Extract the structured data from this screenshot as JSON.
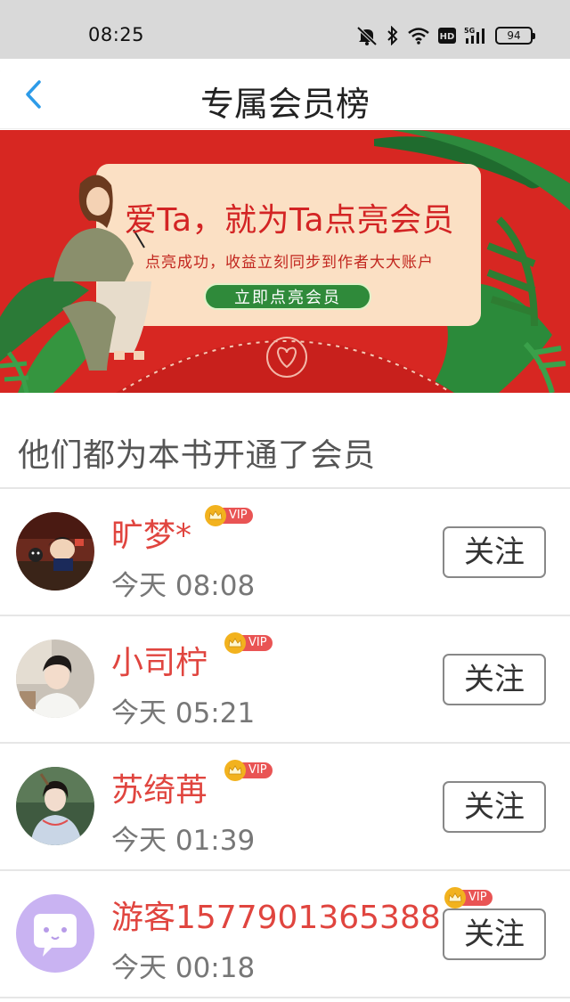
{
  "status_bar": {
    "time": "08:25",
    "icons": [
      "mute-icon",
      "bluetooth-icon",
      "wifi-icon",
      "hd-icon",
      "signal-5g-icon",
      "battery-icon"
    ],
    "battery": "94"
  },
  "header": {
    "back_icon": "chevron-left-icon",
    "title": "专属会员榜"
  },
  "banner": {
    "title": "爱Ta，就为Ta点亮会员",
    "subtitle": "点亮成功，收益立刻同步到作者大大账户",
    "cta": "立即点亮会员"
  },
  "section": {
    "title": "他们都为本书开通了会员"
  },
  "members": [
    {
      "name": "旷梦*",
      "time": "今天 08:08",
      "vip": "VIP",
      "follow": "关注"
    },
    {
      "name": "小司柠",
      "time": "今天 05:21",
      "vip": "VIP",
      "follow": "关注"
    },
    {
      "name": "苏绮苒",
      "time": "今天 01:39",
      "vip": "VIP",
      "follow": "关注"
    },
    {
      "name": "游客1577901365388",
      "time": "今天 00:18",
      "vip": "VIP",
      "follow": "关注"
    }
  ],
  "colors": {
    "accent_name": "#e0453f",
    "banner_red": "#d72722",
    "cta_green": "#2f8a3a",
    "back_arrow": "#2d9be8",
    "vip_badge": "#e95454"
  }
}
